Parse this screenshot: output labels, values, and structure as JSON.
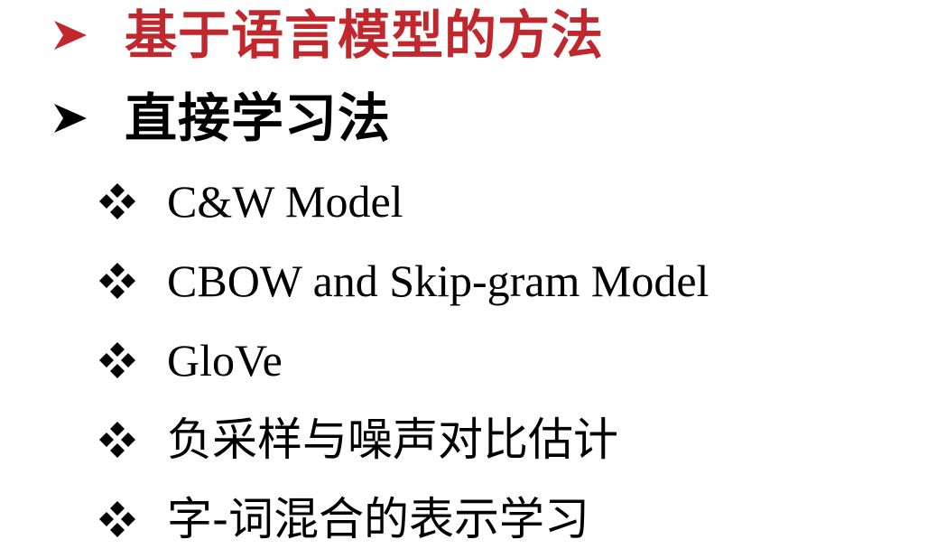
{
  "colors": {
    "accent": "#c0282d",
    "text": "#000000",
    "background": "#ffffff"
  },
  "headings": [
    {
      "text": "基于语言模型的方法",
      "color": "#c0282d",
      "bullet_icon": "arrow-bullet-icon"
    },
    {
      "text": "直接学习法",
      "color": "#000000",
      "bullet_icon": "arrow-bullet-icon"
    }
  ],
  "subitems": [
    {
      "text": "C&W Model",
      "bullet_icon": "diamond-bullet-icon"
    },
    {
      "text": "CBOW and Skip-gram Model",
      "bullet_icon": "diamond-bullet-icon"
    },
    {
      "text": "GloVe",
      "bullet_icon": "diamond-bullet-icon"
    },
    {
      "text": "负采样与噪声对比估计",
      "bullet_icon": "diamond-bullet-icon"
    },
    {
      "text": "字-词混合的表示学习",
      "bullet_icon": "diamond-bullet-icon"
    }
  ]
}
